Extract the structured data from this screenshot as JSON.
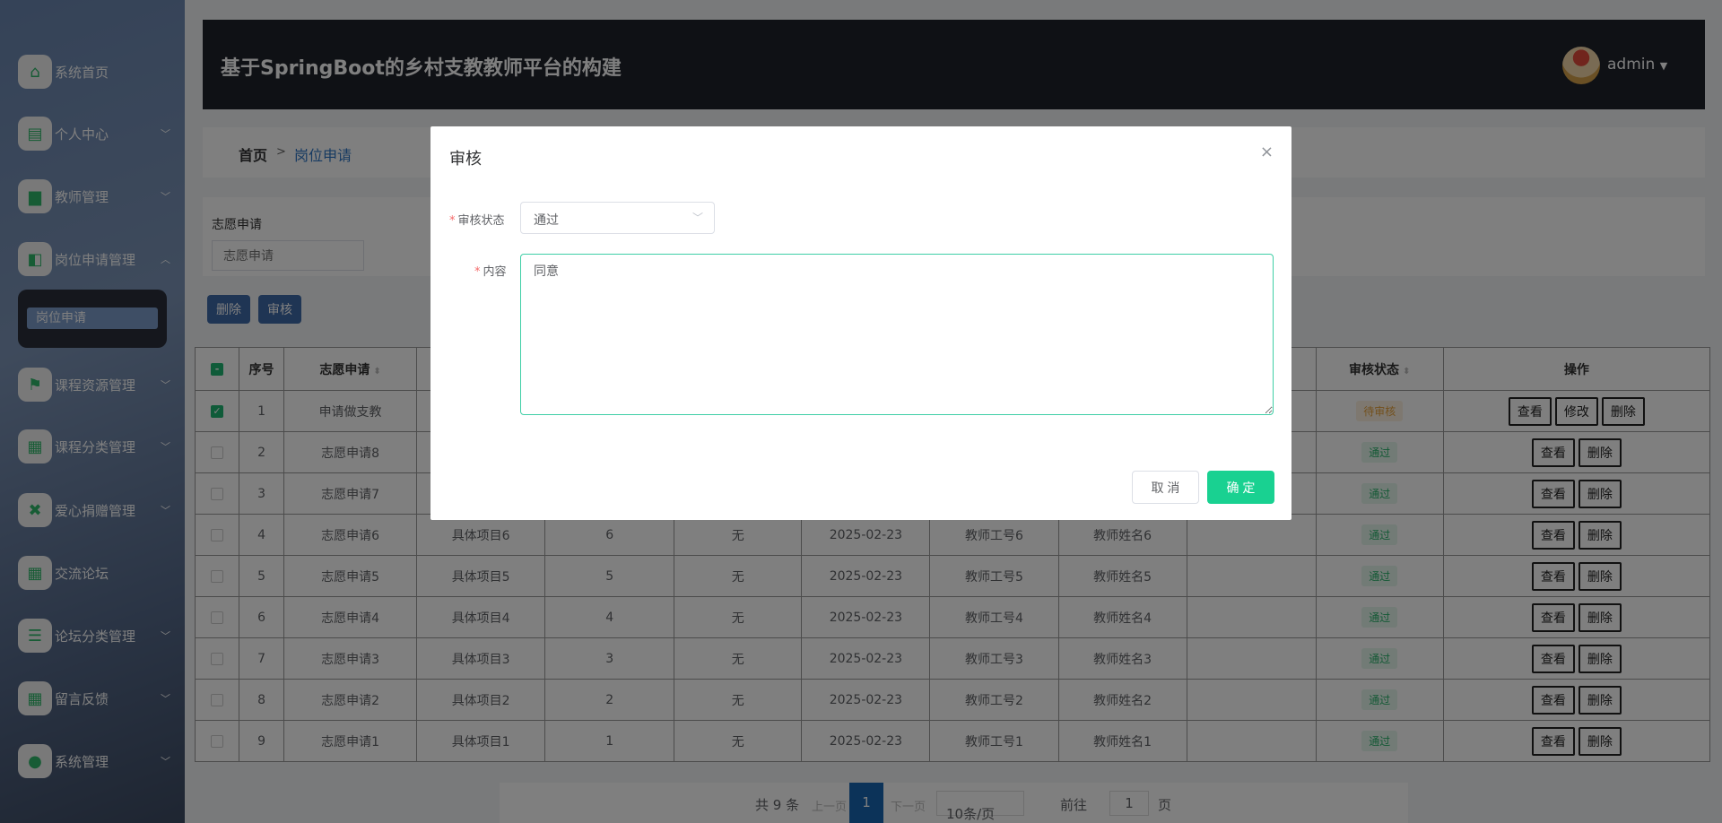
{
  "app": {
    "title": "基于SpringBoot的乡村支教教师平台的构建",
    "user": "admin"
  },
  "sidebar": {
    "items": [
      {
        "label": "系统首页",
        "icon": "home-icon",
        "glyph": "⌂",
        "chev": ""
      },
      {
        "label": "个人中心",
        "icon": "card-icon",
        "glyph": "▤",
        "chev": "﹀"
      },
      {
        "label": "教师管理",
        "icon": "monitor-icon",
        "glyph": "▆",
        "chev": "﹀"
      },
      {
        "label": "岗位申请管理",
        "icon": "wallet-icon",
        "glyph": "◧",
        "chev": "︿"
      },
      {
        "label": "课程资源管理",
        "icon": "flag-icon",
        "glyph": "⚑",
        "chev": "﹀"
      },
      {
        "label": "课程分类管理",
        "icon": "grid-icon",
        "glyph": "▦",
        "chev": "﹀"
      },
      {
        "label": "爱心捐赠管理",
        "icon": "gift-icon",
        "glyph": "✖",
        "chev": "﹀"
      },
      {
        "label": "交流论坛",
        "icon": "grid-icon",
        "glyph": "▦",
        "chev": ""
      },
      {
        "label": "论坛分类管理",
        "icon": "list-icon",
        "glyph": "☰",
        "chev": "﹀"
      },
      {
        "label": "留言反馈",
        "icon": "grid-icon",
        "glyph": "▦",
        "chev": "﹀"
      },
      {
        "label": "系统管理",
        "icon": "user-icon",
        "glyph": "●",
        "chev": "﹀"
      }
    ],
    "submenu": "岗位申请"
  },
  "breadcrumb": {
    "home": "首页",
    "sep": ">",
    "current": "岗位申请"
  },
  "search": {
    "label": "志愿申请",
    "placeholder": "志愿申请"
  },
  "toolbar": {
    "delete": "删除",
    "audit": "审核"
  },
  "table": {
    "headers": [
      "",
      "序号",
      "志愿申请",
      "",
      "",
      "",
      "",
      "",
      "",
      "",
      "审核状态",
      "操作"
    ],
    "rows": [
      {
        "checked": true,
        "cells": [
          "1",
          "申请做支教",
          "",
          "",
          "",
          "",
          "",
          "",
          ""
        ],
        "status": "待审核",
        "ops": [
          "查看",
          "修改",
          "删除"
        ]
      },
      {
        "checked": false,
        "cells": [
          "2",
          "志愿申请8",
          "",
          "",
          "",
          "",
          "",
          "",
          ""
        ],
        "status": "通过",
        "ops": [
          "查看",
          "删除"
        ]
      },
      {
        "checked": false,
        "cells": [
          "3",
          "志愿申请7",
          "",
          "",
          "",
          "",
          "",
          "",
          ""
        ],
        "status": "通过",
        "ops": [
          "查看",
          "删除"
        ]
      },
      {
        "checked": false,
        "cells": [
          "4",
          "志愿申请6",
          "具体项目6",
          "6",
          "无",
          "2025-02-23",
          "教师工号6",
          "教师姓名6",
          ""
        ],
        "status": "通过",
        "ops": [
          "查看",
          "删除"
        ]
      },
      {
        "checked": false,
        "cells": [
          "5",
          "志愿申请5",
          "具体项目5",
          "5",
          "无",
          "2025-02-23",
          "教师工号5",
          "教师姓名5",
          ""
        ],
        "status": "通过",
        "ops": [
          "查看",
          "删除"
        ]
      },
      {
        "checked": false,
        "cells": [
          "6",
          "志愿申请4",
          "具体项目4",
          "4",
          "无",
          "2025-02-23",
          "教师工号4",
          "教师姓名4",
          ""
        ],
        "status": "通过",
        "ops": [
          "查看",
          "删除"
        ]
      },
      {
        "checked": false,
        "cells": [
          "7",
          "志愿申请3",
          "具体项目3",
          "3",
          "无",
          "2025-02-23",
          "教师工号3",
          "教师姓名3",
          ""
        ],
        "status": "通过",
        "ops": [
          "查看",
          "删除"
        ]
      },
      {
        "checked": false,
        "cells": [
          "8",
          "志愿申请2",
          "具体项目2",
          "2",
          "无",
          "2025-02-23",
          "教师工号2",
          "教师姓名2",
          ""
        ],
        "status": "通过",
        "ops": [
          "查看",
          "删除"
        ]
      },
      {
        "checked": false,
        "cells": [
          "9",
          "志愿申请1",
          "具体项目1",
          "1",
          "无",
          "2025-02-23",
          "教师工号1",
          "教师姓名1",
          ""
        ],
        "status": "通过",
        "ops": [
          "查看",
          "删除"
        ]
      }
    ]
  },
  "pager": {
    "total": "共 9 条",
    "prev": "上一页",
    "page": "1",
    "next": "下一页",
    "size": "10条/页",
    "goto": "前往",
    "goto_value": "1",
    "page_unit": "页"
  },
  "modal": {
    "title": "审核",
    "close": "×",
    "status_label": "审核状态",
    "status_value": "通过",
    "content_label": "内容",
    "content_value": "同意",
    "cancel": "取 消",
    "ok": "确 定"
  },
  "colors": {
    "accent": "#19d191",
    "primary": "#3f6aa8",
    "pass": "#29b26b",
    "wait": "#e6a23c"
  }
}
